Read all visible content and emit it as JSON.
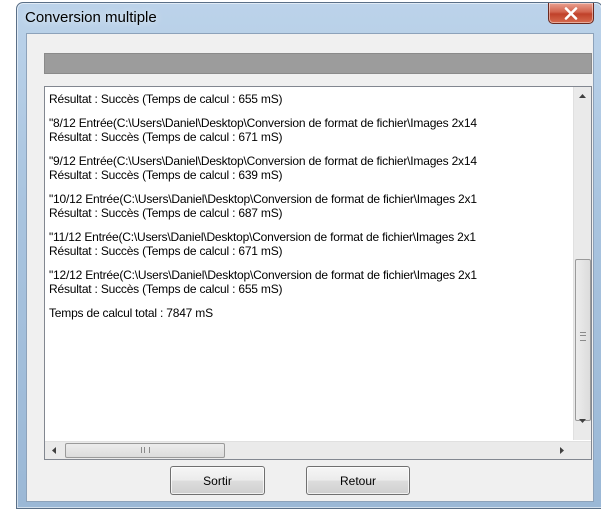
{
  "window": {
    "title": "Conversion multiple",
    "close_symbol": "X"
  },
  "progress": {
    "fraction": 1.0
  },
  "log": {
    "lines": [
      "Résultat : Succès (Temps de calcul : 655 mS)",
      "",
      "\"8/12 Entrée(C:\\Users\\Daniel\\Desktop\\Conversion de format de fichier\\Images 2x14",
      "Résultat : Succès (Temps de calcul : 671 mS)",
      "",
      "\"9/12 Entrée(C:\\Users\\Daniel\\Desktop\\Conversion de format de fichier\\Images 2x14",
      "Résultat : Succès (Temps de calcul : 639 mS)",
      "",
      "\"10/12 Entrée(C:\\Users\\Daniel\\Desktop\\Conversion de format de fichier\\Images 2x1",
      "Résultat : Succès (Temps de calcul : 687 mS)",
      "",
      "\"11/12 Entrée(C:\\Users\\Daniel\\Desktop\\Conversion de format de fichier\\Images 2x1",
      "Résultat : Succès (Temps de calcul : 671 mS)",
      "",
      "\"12/12 Entrée(C:\\Users\\Daniel\\Desktop\\Conversion de format de fichier\\Images 2x1",
      "Résultat : Succès (Temps de calcul : 655 mS)",
      "",
      "Temps de calcul total : 7847 mS"
    ]
  },
  "buttons": {
    "sortir": "Sortir",
    "retour": "Retour"
  },
  "icons": {
    "close": "close-icon",
    "scroll_up": "chevron-up-icon",
    "scroll_down": "chevron-down-icon",
    "scroll_left": "chevron-left-icon",
    "scroll_right": "chevron-right-icon"
  },
  "colors": {
    "close_button": "#c8472f",
    "title_bar": "#b0c9e3",
    "dialog_background": "#f0f0f0"
  }
}
